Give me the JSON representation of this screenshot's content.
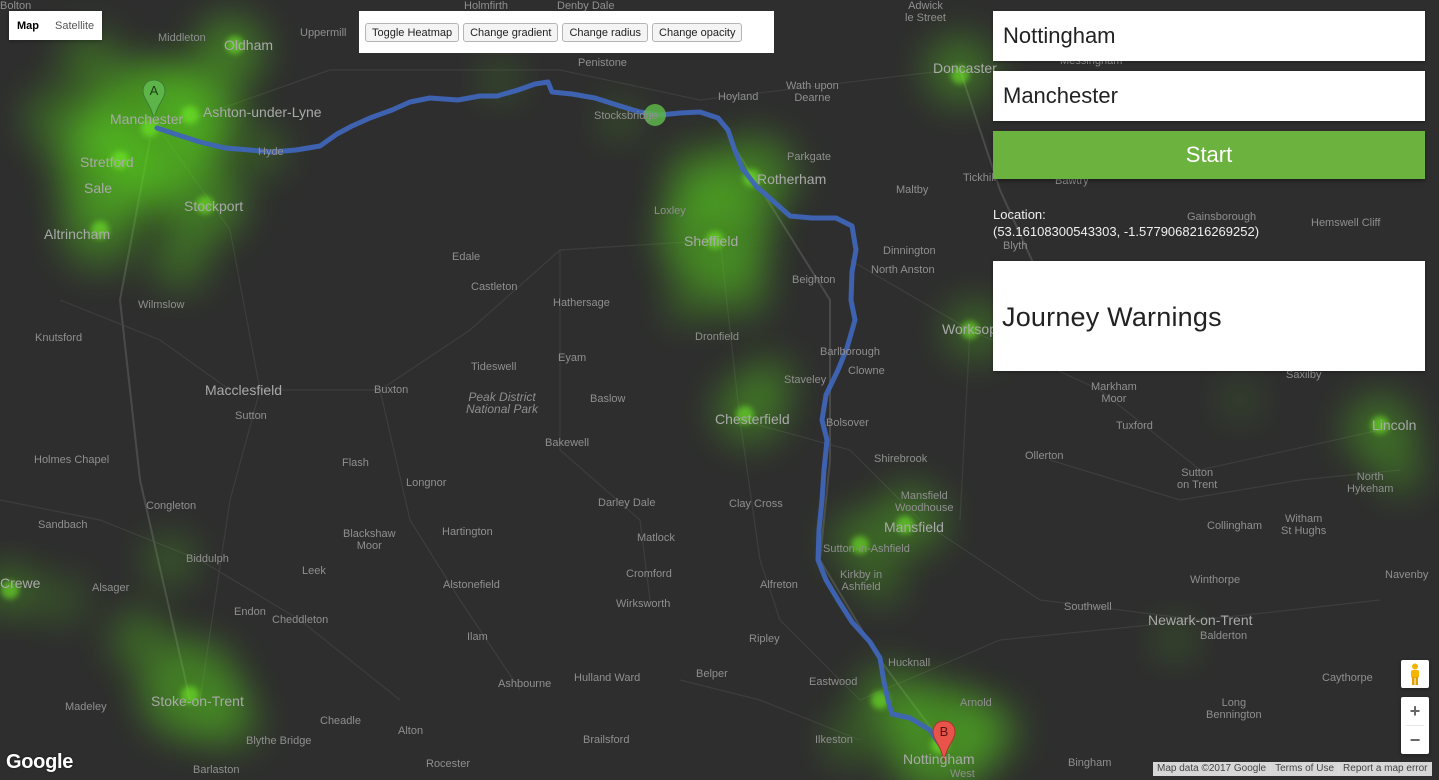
{
  "map_type": {
    "map_label": "Map",
    "satellite_label": "Satellite"
  },
  "heatmap_controls": {
    "toggle": "Toggle Heatmap",
    "gradient": "Change gradient",
    "radius": "Change radius",
    "opacity": "Change opacity"
  },
  "journey": {
    "start_value": "Nottingham",
    "end_value": "Manchester",
    "start_button": "Start",
    "location_label": "Location:",
    "location_value": "(53.16108300543303, -1.5779068216269252)",
    "warnings_title": "Journey Warnings"
  },
  "markers": {
    "a": "A",
    "b": "B"
  },
  "places": [
    {
      "name": "Manchester",
      "cls": "city"
    },
    {
      "name": "Oldham",
      "cls": "city"
    },
    {
      "name": "Middleton",
      "cls": ""
    },
    {
      "name": "Ashton-under-Lyne",
      "cls": "city"
    },
    {
      "name": "Stretford",
      "cls": "city"
    },
    {
      "name": "Sale",
      "cls": "city"
    },
    {
      "name": "Stockport",
      "cls": "city"
    },
    {
      "name": "Hyde",
      "cls": ""
    },
    {
      "name": "Altrincham",
      "cls": "city"
    },
    {
      "name": "Wilmslow",
      "cls": ""
    },
    {
      "name": "Knutsford",
      "cls": ""
    },
    {
      "name": "Macclesfield",
      "cls": "city"
    },
    {
      "name": "Sutton",
      "cls": ""
    },
    {
      "name": "Holmes Chapel",
      "cls": ""
    },
    {
      "name": "Congleton",
      "cls": ""
    },
    {
      "name": "Sandbach",
      "cls": ""
    },
    {
      "name": "Biddulph",
      "cls": ""
    },
    {
      "name": "Alsager",
      "cls": ""
    },
    {
      "name": "Leek",
      "cls": ""
    },
    {
      "name": "Endon",
      "cls": ""
    },
    {
      "name": "Cheddleton",
      "cls": ""
    },
    {
      "name": "Stoke-on-Trent",
      "cls": "city"
    },
    {
      "name": "Madeley",
      "cls": ""
    },
    {
      "name": "Cheadle",
      "cls": ""
    },
    {
      "name": "Blythe Bridge",
      "cls": ""
    },
    {
      "name": "Barlaston",
      "cls": ""
    },
    {
      "name": "Alton",
      "cls": ""
    },
    {
      "name": "Rocester",
      "cls": ""
    },
    {
      "name": "Brailsford",
      "cls": ""
    },
    {
      "name": "Ashbourne",
      "cls": ""
    },
    {
      "name": "Hulland Ward",
      "cls": ""
    },
    {
      "name": "Ilam",
      "cls": ""
    },
    {
      "name": "Alstonefield",
      "cls": ""
    },
    {
      "name": "Hartington",
      "cls": ""
    },
    {
      "name": "Blackshaw\nMoor",
      "cls": ""
    },
    {
      "name": "Longnor",
      "cls": ""
    },
    {
      "name": "Flash",
      "cls": ""
    },
    {
      "name": "Buxton",
      "cls": ""
    },
    {
      "name": "Tideswell",
      "cls": ""
    },
    {
      "name": "Eyam",
      "cls": ""
    },
    {
      "name": "Peak District\nNational Park",
      "cls": "italic"
    },
    {
      "name": "Baslow",
      "cls": ""
    },
    {
      "name": "Bakewell",
      "cls": ""
    },
    {
      "name": "Edale",
      "cls": ""
    },
    {
      "name": "Castleton",
      "cls": ""
    },
    {
      "name": "Hathersage",
      "cls": ""
    },
    {
      "name": "Darley Dale",
      "cls": ""
    },
    {
      "name": "Matlock",
      "cls": ""
    },
    {
      "name": "Cromford",
      "cls": ""
    },
    {
      "name": "Wirksworth",
      "cls": ""
    },
    {
      "name": "Belper",
      "cls": ""
    },
    {
      "name": "Ripley",
      "cls": ""
    },
    {
      "name": "Alfreton",
      "cls": ""
    },
    {
      "name": "Clay Cross",
      "cls": ""
    },
    {
      "name": "Chesterfield",
      "cls": "city"
    },
    {
      "name": "Staveley",
      "cls": ""
    },
    {
      "name": "Bolsover",
      "cls": ""
    },
    {
      "name": "Barlborough",
      "cls": ""
    },
    {
      "name": "Clowne",
      "cls": ""
    },
    {
      "name": "Dronfield",
      "cls": ""
    },
    {
      "name": "Sheffield",
      "cls": "city"
    },
    {
      "name": "Loxley",
      "cls": ""
    },
    {
      "name": "Rotherham",
      "cls": "city"
    },
    {
      "name": "Parkgate",
      "cls": ""
    },
    {
      "name": "Beighton",
      "cls": ""
    },
    {
      "name": "Dinnington",
      "cls": ""
    },
    {
      "name": "North Anston",
      "cls": ""
    },
    {
      "name": "Maltby",
      "cls": ""
    },
    {
      "name": "Stocksbridge",
      "cls": ""
    },
    {
      "name": "Hoyland",
      "cls": ""
    },
    {
      "name": "Wath upon\nDearne",
      "cls": ""
    },
    {
      "name": "Penistone",
      "cls": ""
    },
    {
      "name": "Uppermill",
      "cls": ""
    },
    {
      "name": "Holmfirth",
      "cls": ""
    },
    {
      "name": "Denby Dale",
      "cls": ""
    },
    {
      "name": "Doncaster",
      "cls": "city"
    },
    {
      "name": "Adwick\nle Street",
      "cls": ""
    },
    {
      "name": "Messingham",
      "cls": ""
    },
    {
      "name": "Tickhill",
      "cls": ""
    },
    {
      "name": "Bawtry",
      "cls": ""
    },
    {
      "name": "Gainsborough",
      "cls": ""
    },
    {
      "name": "Hemswell Cliff",
      "cls": ""
    },
    {
      "name": "Blyth",
      "cls": ""
    },
    {
      "name": "Worksop",
      "cls": "city"
    },
    {
      "name": "Saxilby",
      "cls": ""
    },
    {
      "name": "Markham\nMoor",
      "cls": ""
    },
    {
      "name": "Tuxford",
      "cls": ""
    },
    {
      "name": "Lincoln",
      "cls": "city"
    },
    {
      "name": "Ollerton",
      "cls": ""
    },
    {
      "name": "North\nHykeham",
      "cls": ""
    },
    {
      "name": "Sutton\non Trent",
      "cls": ""
    },
    {
      "name": "Shirebrook",
      "cls": ""
    },
    {
      "name": "Mansfield\nWoodhouse",
      "cls": ""
    },
    {
      "name": "Mansfield",
      "cls": "city"
    },
    {
      "name": "Sutton-in-Ashfield",
      "cls": ""
    },
    {
      "name": "Kirkby in\nAshfield",
      "cls": ""
    },
    {
      "name": "Collingham",
      "cls": ""
    },
    {
      "name": "Witham\nSt Hughs",
      "cls": ""
    },
    {
      "name": "Navenby",
      "cls": ""
    },
    {
      "name": "Winthorpe",
      "cls": ""
    },
    {
      "name": "Southwell",
      "cls": ""
    },
    {
      "name": "Newark-on-Trent",
      "cls": "city"
    },
    {
      "name": "Balderton",
      "cls": ""
    },
    {
      "name": "Hucknall",
      "cls": ""
    },
    {
      "name": "Eastwood",
      "cls": ""
    },
    {
      "name": "Arnold",
      "cls": ""
    },
    {
      "name": "Ilkeston",
      "cls": ""
    },
    {
      "name": "Nottingham",
      "cls": "city"
    },
    {
      "name": "Bingham",
      "cls": ""
    },
    {
      "name": "Long\nBennington",
      "cls": ""
    },
    {
      "name": "Caythorpe",
      "cls": ""
    },
    {
      "name": "Crewe",
      "cls": "city"
    },
    {
      "name": "Bolton",
      "cls": ""
    },
    {
      "name": "West",
      "cls": ""
    }
  ],
  "footer": {
    "brand": "Google",
    "map_data": "Map data ©2017 Google",
    "terms": "Terms of Use",
    "report": "Report a map error"
  },
  "colors": {
    "route": "#3f65b7",
    "start_button": "#6bb23f",
    "heat": "#5cdc1e",
    "marker_a": "#5db54a",
    "marker_b": "#e8534a"
  }
}
